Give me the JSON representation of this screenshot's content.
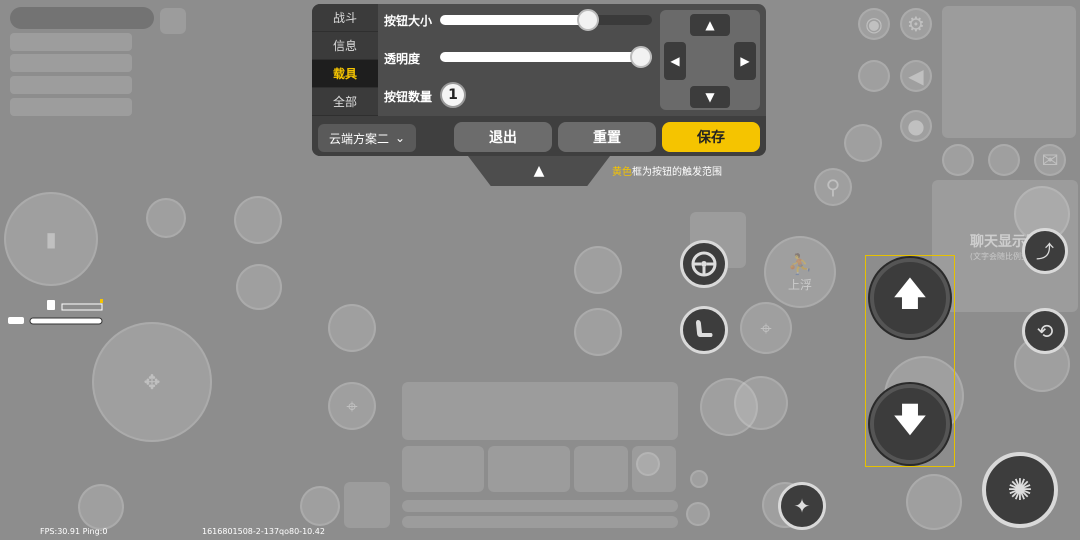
{
  "panel": {
    "tabs": [
      {
        "label": "战斗",
        "active": false
      },
      {
        "label": "信息",
        "active": false
      },
      {
        "label": "载具",
        "active": true
      },
      {
        "label": "全部",
        "active": false
      }
    ],
    "size_label": "按钮大小",
    "size_value": 0.7,
    "opacity_label": "透明度",
    "opacity_value": 1.0,
    "count_label": "按钮数量",
    "count_value": "1",
    "scheme_label": "云端方案二",
    "exit_label": "退出",
    "reset_label": "重置",
    "save_label": "保存"
  },
  "hint": {
    "highlight": "黄色",
    "text": "框为按钮的触发范围"
  },
  "hud": {
    "fps_text": "FPS:30.91 Ping:0",
    "build_text": "1616801508-2-137qo80-10.42",
    "float_up_label": "上浮",
    "chat_label": "聊天显示区",
    "chat_sub_label": "(文字会随比例变化)"
  },
  "colors": {
    "accent": "#f5c400",
    "panel_bg": "#4d4d4d",
    "screen_bg": "#8d8d8d"
  }
}
